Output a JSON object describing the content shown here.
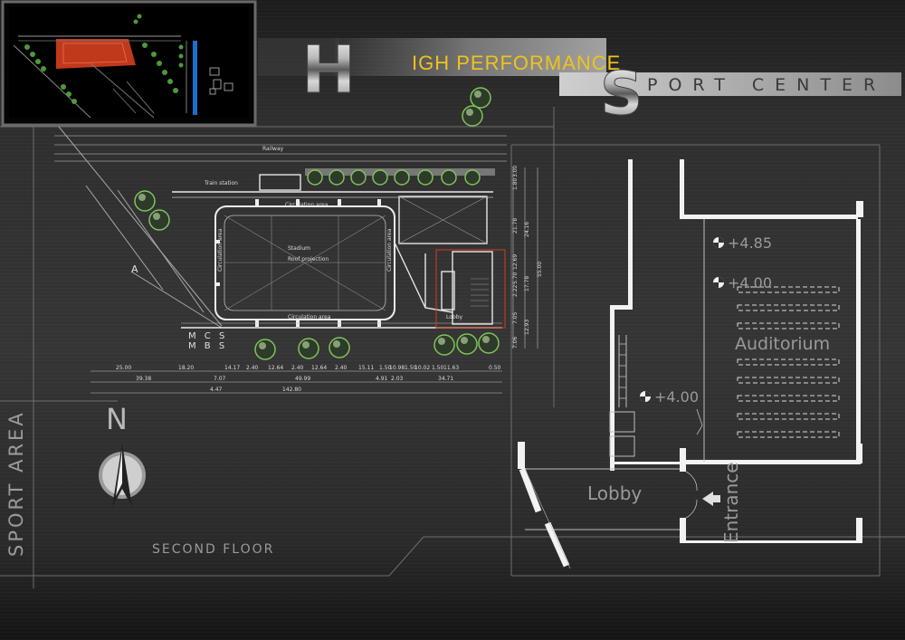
{
  "title": {
    "line1_initial": "H",
    "line1_rest": "IGH PERFORMANCE",
    "line2_initial": "S",
    "line2_rest": "PORT CENTER"
  },
  "side_label": "SPORT AREA",
  "floor_label": "SECOND FLOOR",
  "north_letter": "N",
  "site_plan": {
    "railway": "Railway",
    "train_station": "Train station",
    "stadium": "Stadium",
    "stadium_sub": "Roof projection",
    "circulation_top": "Circulation area",
    "circulation_bottom": "Circulation area",
    "circulation_left": "Circulation area",
    "circulation_right": "Circulation area",
    "lobby": "Lobby",
    "section_mark": "A",
    "legend_1": "M C S",
    "legend_2": "M B S",
    "dims_row1": [
      "25.00",
      "18.20",
      "14.17",
      "2.40",
      "12.64",
      "2.40",
      "12.64",
      "2.40",
      "15.11",
      "1.50",
      "10.98",
      "1.50",
      "10.02",
      "1.50",
      "11.63",
      "0.50"
    ],
    "dims_row2": [
      "39.38",
      "7.07",
      "49.99",
      "4.91",
      "2.03",
      "34.71"
    ],
    "dims_row3": [
      "4.47",
      "142.80"
    ],
    "dims_right_a": [
      "1.80",
      "3.00",
      "21.78",
      "12.69",
      "5.70",
      "2.22",
      "7.05",
      "7.06"
    ],
    "dims_right_b": [
      "24.16",
      "17.78",
      "12.93"
    ],
    "dims_right_c": [
      "55.00"
    ]
  },
  "detail_plan": {
    "level_1": "+4.85",
    "level_2": "+4.00",
    "level_3": "+4.00",
    "auditorium": "Auditorium",
    "lobby": "Lobby",
    "entrance": "Entrance"
  },
  "colors": {
    "title_gold": "#f2c21a",
    "tree_green": "#7fc35c",
    "highlight_red": "#c0391b",
    "water_blue": "#1a6fd0"
  }
}
